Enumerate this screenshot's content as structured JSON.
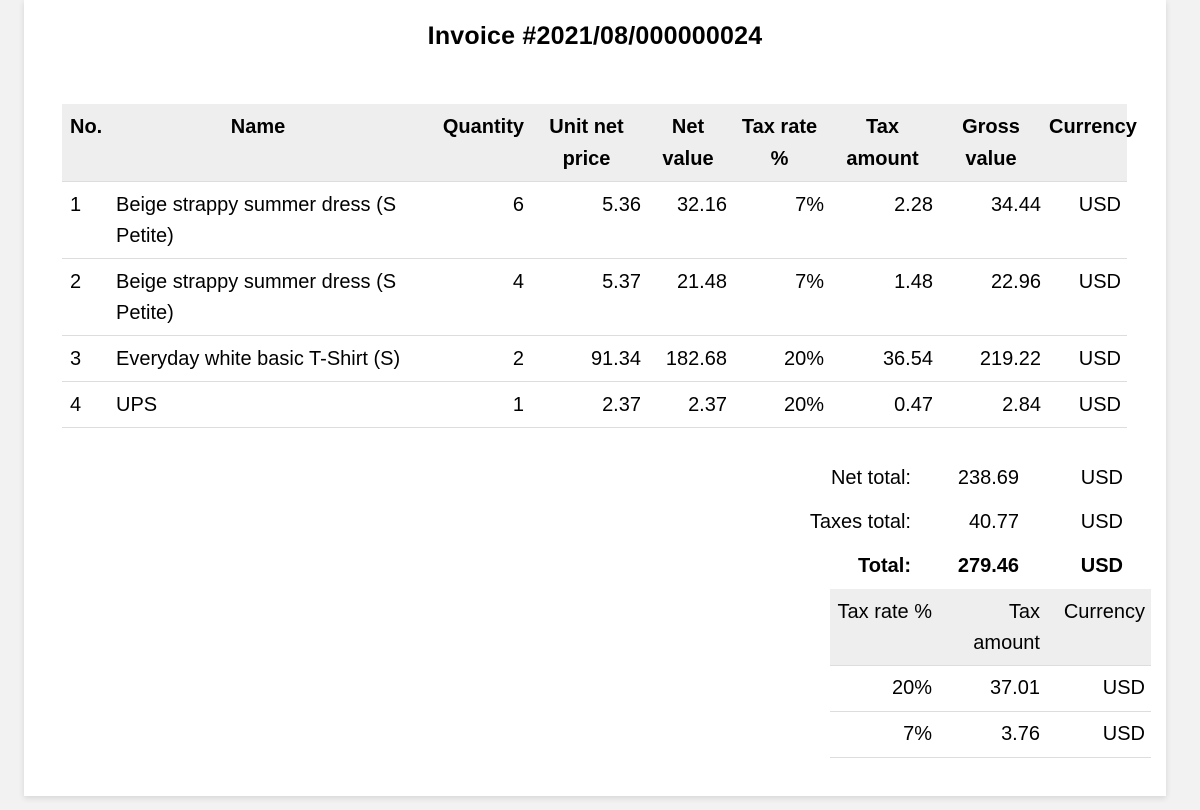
{
  "invoice": {
    "title": "Invoice #2021/08/000000024"
  },
  "items_table": {
    "headers": {
      "no": "No.",
      "name": "Name",
      "quantity": "Quantity",
      "unit_net_price": "Unit net price",
      "net_value": "Net value",
      "tax_rate": "Tax rate %",
      "tax_amount": "Tax amount",
      "gross_value": "Gross value",
      "currency": "Currency"
    },
    "rows": [
      {
        "no": "1",
        "name": "Beige strappy summer dress (S Petite)",
        "quantity": "6",
        "unit_net_price": "5.36",
        "net_value": "32.16",
        "tax_rate": "7%",
        "tax_amount": "2.28",
        "gross_value": "34.44",
        "currency": "USD"
      },
      {
        "no": "2",
        "name": "Beige strappy summer dress (S Petite)",
        "quantity": "4",
        "unit_net_price": "5.37",
        "net_value": "21.48",
        "tax_rate": "7%",
        "tax_amount": "1.48",
        "gross_value": "22.96",
        "currency": "USD"
      },
      {
        "no": "3",
        "name": "Everyday white basic T-Shirt (S)",
        "quantity": "2",
        "unit_net_price": "91.34",
        "net_value": "182.68",
        "tax_rate": "20%",
        "tax_amount": "36.54",
        "gross_value": "219.22",
        "currency": "USD"
      },
      {
        "no": "4",
        "name": "UPS",
        "quantity": "1",
        "unit_net_price": "2.37",
        "net_value": "2.37",
        "tax_rate": "20%",
        "tax_amount": "0.47",
        "gross_value": "2.84",
        "currency": "USD"
      }
    ]
  },
  "totals": {
    "net_total": {
      "label": "Net total:",
      "value": "238.69",
      "currency": "USD"
    },
    "taxes_total": {
      "label": "Taxes total:",
      "value": "40.77",
      "currency": "USD"
    },
    "total": {
      "label": "Total:",
      "value": "279.46",
      "currency": "USD"
    }
  },
  "tax_summary": {
    "headers": {
      "tax_rate": "Tax rate %",
      "tax_amount": "Tax amount",
      "currency": "Currency"
    },
    "rows": [
      {
        "tax_rate": "20%",
        "tax_amount": "37.01",
        "currency": "USD"
      },
      {
        "tax_rate": "7%",
        "tax_amount": "3.76",
        "currency": "USD"
      }
    ]
  }
}
